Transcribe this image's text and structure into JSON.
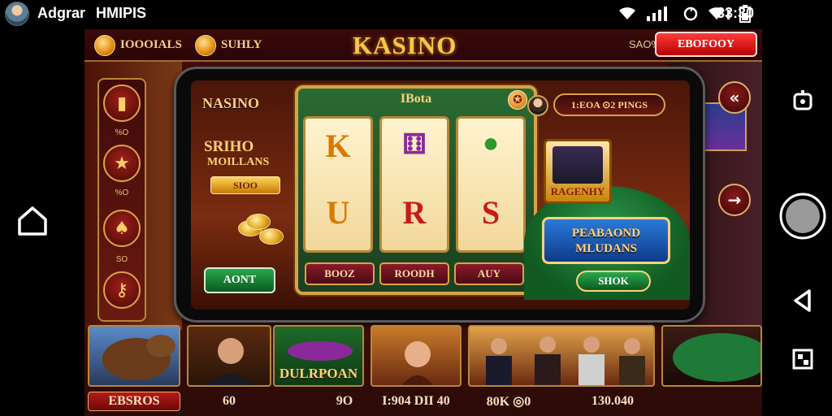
{
  "status_bar": {
    "user_name": "Adgrar",
    "app_name": "HMIPIS",
    "time": "33:30",
    "icons": [
      "wifi-icon",
      "signal-icon",
      "sync-icon",
      "wifi-icon",
      "battery-icon"
    ]
  },
  "game": {
    "top_bar": {
      "left_label_1": "IOOOIALS",
      "left_label_2": "SUHLY",
      "brand": "KASINO",
      "small_text": "SAO%",
      "cta": "EBOFOOY"
    },
    "left_menu": {
      "labels": [
        "%O",
        "%O",
        "SO"
      ]
    },
    "phone": {
      "title": "NASINO",
      "promo_line1": "SRIHO",
      "promo_line2": "MOILLANS",
      "promo_button": "SIOO",
      "action_button": "AONT",
      "slot": {
        "header": "IBota",
        "gear": "✪",
        "symbols": [
          "K",
          "U",
          "R",
          "S"
        ],
        "buttons": [
          "BOOZ",
          "ROODH",
          "AUY"
        ]
      },
      "balance": "1:EOA ⊙2 PINGS",
      "card_label": "RAGENHY",
      "banner_line1": "PEABAOND",
      "banner_line2": "MLUDANS",
      "show_button": "SHOK"
    },
    "tiles": [
      {
        "caption": "EBSROS",
        "name": "bull-tile"
      },
      {
        "caption": "60",
        "name": "player-tile"
      },
      {
        "caption": "DULRPOAN",
        "name": "dulrpoan-tile"
      },
      {
        "caption": "I:904 DII 40",
        "name": "woman-tile"
      },
      {
        "caption": "80K ◎0",
        "name": "winners-tile"
      },
      {
        "caption": "130.040",
        "name": "roulette-tile"
      }
    ],
    "tile_caption_middle": "9O"
  },
  "colors": {
    "accent_gold": "#f7c64a",
    "cta_red": "#d80000",
    "felt_green": "#1e7a36",
    "maroon": "#4a0c0a"
  }
}
